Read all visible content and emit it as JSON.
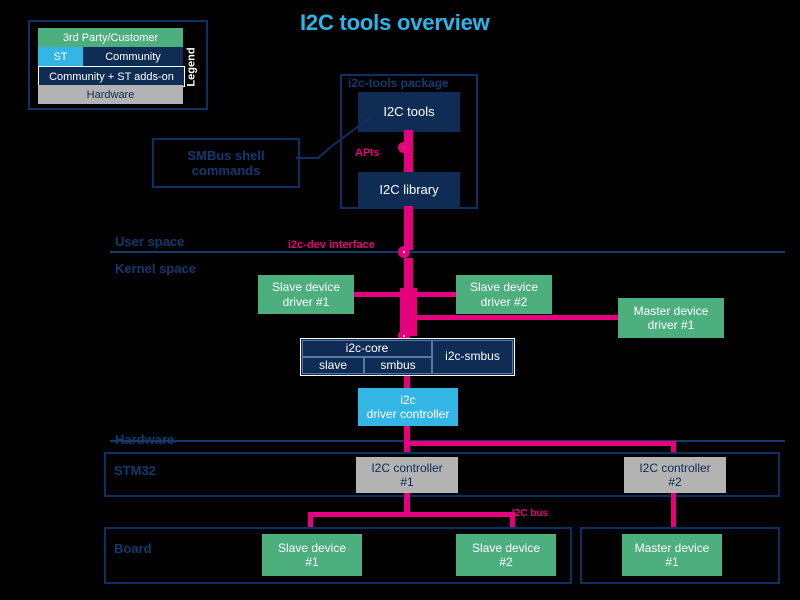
{
  "title": "I2C tools overview",
  "legend": {
    "vertical_label": "Legend",
    "rows": [
      {
        "label": "3rd Party/Customer",
        "color": "#4CAF7D"
      },
      {
        "label": "ST",
        "color": "#33B5E5"
      },
      {
        "label": "Community",
        "color": "#0E2C54"
      },
      {
        "label": "Community + ST adds-on",
        "color": "#33B5E5"
      },
      {
        "label": "Hardware",
        "color": "#B3B3B3"
      }
    ]
  },
  "user_space": {
    "section_label": "User space",
    "package_label": "i2c-tools package",
    "i2c_tools": "I2C tools",
    "i2c_library": "I2C library",
    "api_label": "APIs",
    "shell_commands": "SMBus shell\ncommands",
    "shell_commands_line1": "SMBus shell",
    "shell_commands_line2": "commands"
  },
  "boundary": {
    "i2c_dev_interface": "i2c-dev interface"
  },
  "kernel_space": {
    "section_label": "Kernel space",
    "slave_driver_1_l1": "Slave device",
    "slave_driver_1_l2": "driver #1",
    "slave_driver_2_l1": "Slave device",
    "slave_driver_2_l2": "driver #2",
    "master_driver_1_l1": "Master device",
    "master_driver_1_l2": "driver #1",
    "i2c_core": "i2c-core",
    "i2c_core_slave": "slave",
    "i2c_core_smbus": "smbus",
    "i2c_smbus": "i2c-smbus",
    "driver_controller_l1": "i2c",
    "driver_controller_l2": "driver controller"
  },
  "hardware": {
    "section_label": "Hardware",
    "soc_label": "STM32",
    "controller_1_l1": "I2C controller",
    "controller_1_l2": "#1",
    "controller_2_l1": "I2C controller",
    "controller_2_l2": "#2",
    "board_label": "Board",
    "bus_label": "I2C bus",
    "slave_device_1_l1": "Slave device",
    "slave_device_1_l2": "#1",
    "slave_device_2_l1": "Slave device",
    "slave_device_2_l2": "#2",
    "master_device_1_l1": "Master device",
    "master_device_1_l2": "#1"
  },
  "colors": {
    "background": "#000000",
    "title": "#29B6E8",
    "navy": "#0E2C54",
    "navy_text": "#123A6E",
    "green": "#4CAF7D",
    "cyan": "#33B5E5",
    "gray": "#B3B3B3",
    "pink": "#E6007E",
    "border": "#0D2F63"
  }
}
